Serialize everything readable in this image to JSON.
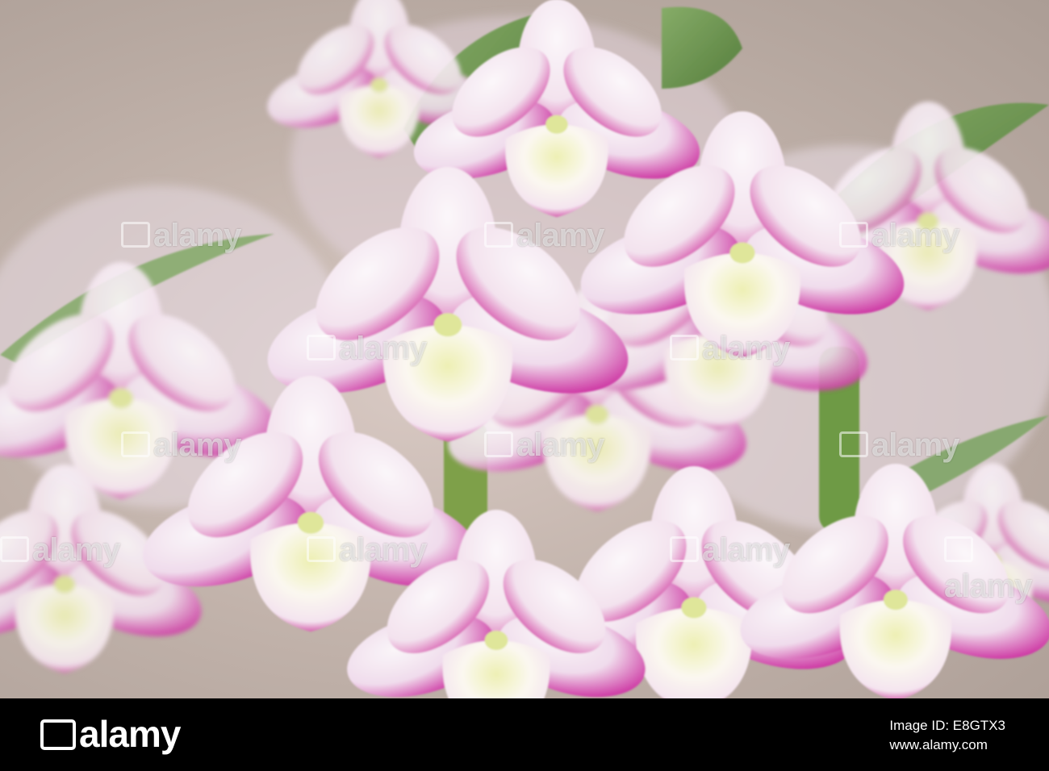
{
  "photo": {
    "subject": "orchid-flowers",
    "colors": {
      "background": "#c2b3ab",
      "petal_white": "#f6f0f4",
      "petal_magenta": "#c2188a",
      "petal_light_pink": "#eecde4",
      "lip_yellow": "#eef0b4",
      "leaf_green": "#6e9a52",
      "stem_green": "#7ea04a"
    }
  },
  "watermarks": {
    "text": "alamy"
  },
  "footer": {
    "logo_text": "alamy",
    "image_id_label": "Image ID: E8GTX3",
    "website": "www.alamy.com"
  }
}
